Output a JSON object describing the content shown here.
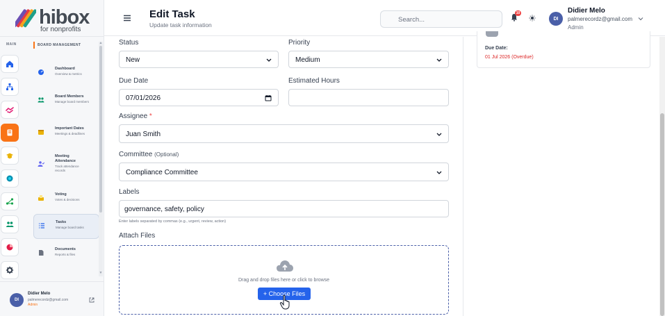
{
  "brand": {
    "name": "hibox",
    "tagline": "for nonprofits"
  },
  "nav": {
    "main_label": "MAIN",
    "section_header": "BOARD MANAGEMENT",
    "rail_icons": [
      "home-icon",
      "org-chart-icon",
      "handshake-icon",
      "board-icon",
      "graduation-icon",
      "globe-icon",
      "network-icon",
      "people-icon",
      "chart-icon",
      "gear-icon"
    ],
    "items": [
      {
        "title": "Dashboard",
        "desc": "Overview & metrics",
        "icon": "dashboard-icon"
      },
      {
        "title": "Board Members",
        "desc": "Manage board members",
        "icon": "members-icon"
      },
      {
        "title": "Important Dates",
        "desc": "Meetings & deadlines",
        "icon": "calendar-icon"
      },
      {
        "title": "Meeting Attendance",
        "desc": "Track attendance records",
        "icon": "attendance-icon"
      },
      {
        "title": "Voting",
        "desc": "Votes & decisions",
        "icon": "vote-icon"
      },
      {
        "title": "Tasks",
        "desc": "Manage board tasks",
        "icon": "tasks-icon"
      },
      {
        "title": "Documents",
        "desc": "Reports & files",
        "icon": "document-icon"
      }
    ],
    "active_index": 5,
    "user": {
      "initials": "DI",
      "name": "Didier Melo",
      "email": "palmerecordz@gmail.com",
      "role": "Admin"
    }
  },
  "header": {
    "title": "Edit Task",
    "subtitle": "Update task information",
    "search_placeholder": "Search...",
    "notification_count": "10",
    "user": {
      "initials": "DI",
      "name": "Didier Melo",
      "email": "palmerecordz@gmail.com",
      "role": "Admin"
    }
  },
  "form": {
    "status": {
      "label": "Status",
      "value": "New"
    },
    "priority": {
      "label": "Priority",
      "value": "Medium"
    },
    "due_date": {
      "label": "Due Date",
      "value": "07/01/2026"
    },
    "estimated_hours": {
      "label": "Estimated Hours",
      "value": ""
    },
    "assignee": {
      "label": "Assignee",
      "required": "*",
      "value": "Juan Smith"
    },
    "committee": {
      "label": "Committee",
      "optional": "(Optional)",
      "value": "Compliance Committee"
    },
    "labels": {
      "label": "Labels",
      "value": "governance, safety, policy",
      "hint": "Enter labels separated by commas (e.g., urgent, review, action)"
    },
    "attach": {
      "label": "Attach Files",
      "drop_text": "Drag and drop files here or click to browse",
      "button": "+ Choose Files"
    }
  },
  "summary": {
    "due_label": "Due Date:",
    "due_value": "01 Jul 2026 (Overdue)"
  },
  "colors": {
    "accent": "#f97316",
    "primary": "#2563eb",
    "avatar": "#4a5fa8",
    "danger": "#dc2626"
  }
}
